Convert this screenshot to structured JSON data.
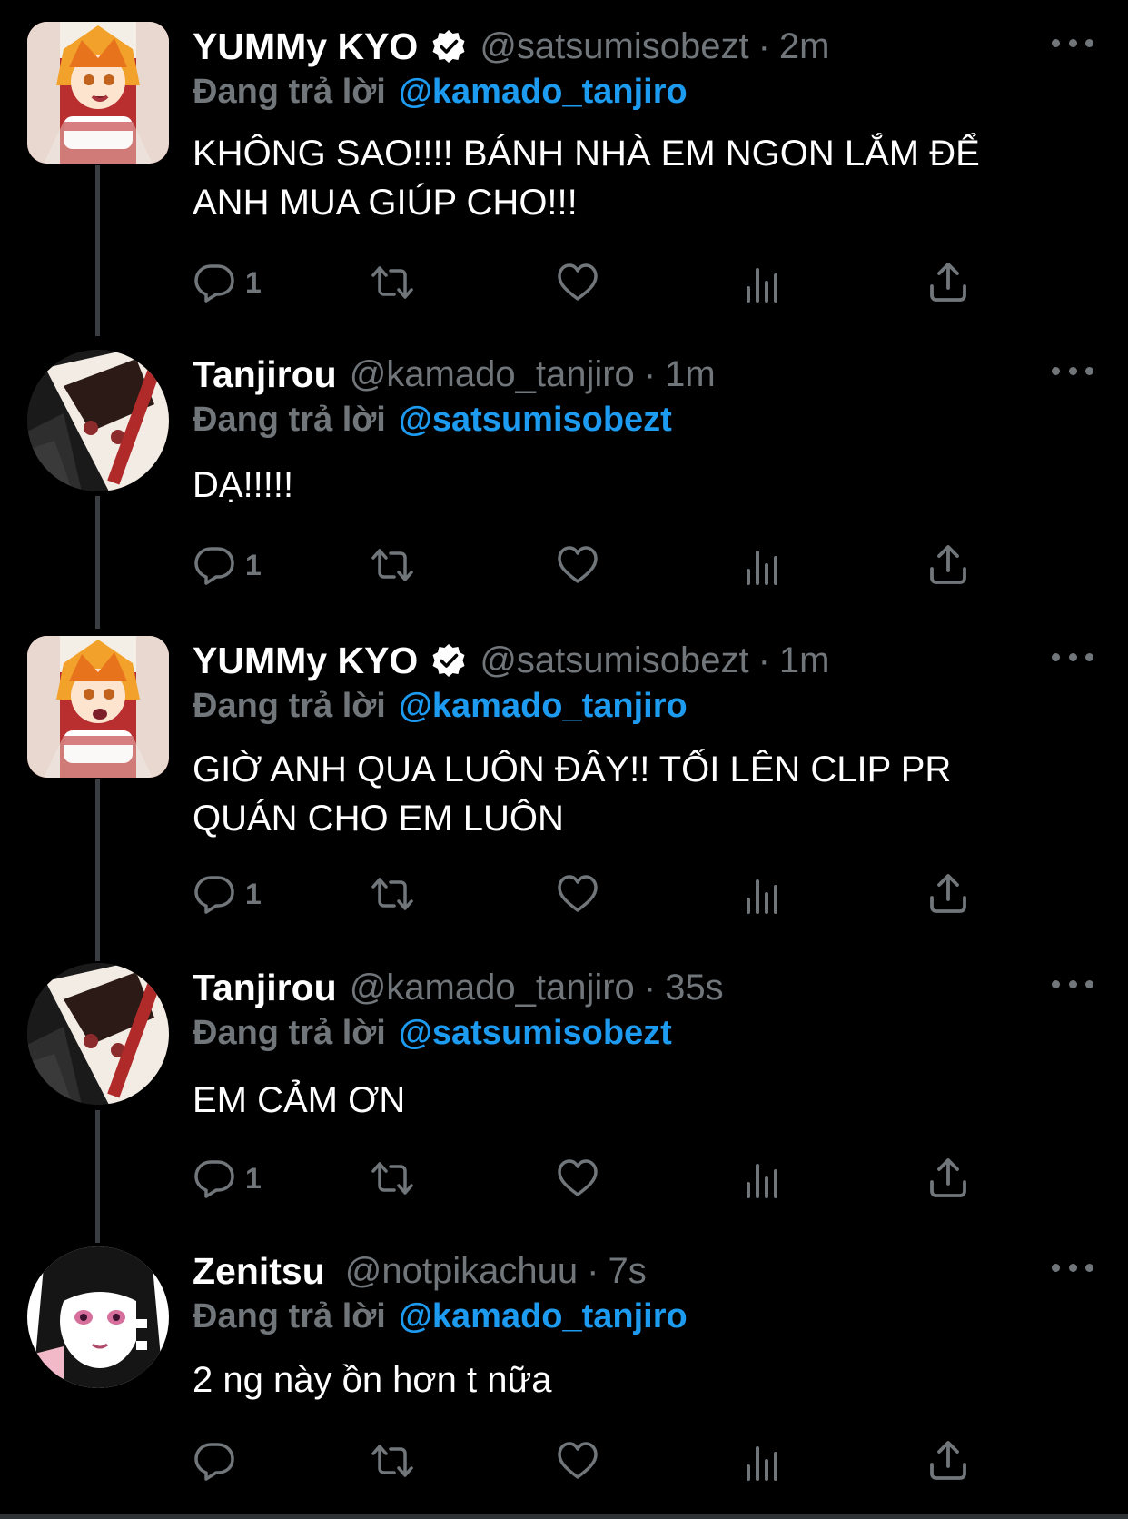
{
  "colors": {
    "background": "#000000",
    "text": "#ffffff",
    "muted": "#71767b",
    "link": "#1d9bf0",
    "thread_line": "#3a3d41"
  },
  "tweets": [
    {
      "display_name": "YUMMy KYO",
      "verified": true,
      "handle": "@satsumisobezt",
      "separator": "·",
      "time": "2m",
      "replying_label": "Đang trả lời",
      "replying_to": "@kamado_tanjiro",
      "text_lines": [
        "KHÔNG SAO!!!! BÁNH NHÀ EM NGON LẮM ĐỂ",
        "ANH MUA GIÚP CHO!!!"
      ],
      "reply_count": "1",
      "avatar_icon": "rengoku-avatar"
    },
    {
      "display_name": "Tanjirou",
      "verified": false,
      "handle": "@kamado_tanjiro",
      "separator": "·",
      "time": "1m",
      "replying_label": "Đang trả lời",
      "replying_to": "@satsumisobezt",
      "text_lines": [
        "DẠ!!!!!"
      ],
      "reply_count": "1",
      "avatar_icon": "tanjiro-avatar"
    },
    {
      "display_name": "YUMMy KYO",
      "verified": true,
      "handle": "@satsumisobezt",
      "separator": "·",
      "time": "1m",
      "replying_label": "Đang trả lời",
      "replying_to": "@kamado_tanjiro",
      "text_lines": [
        "GIỜ ANH QUA LUÔN ĐÂY!! TỐI LÊN CLIP PR",
        "QUÁN CHO EM LUÔN"
      ],
      "reply_count": "1",
      "avatar_icon": "rengoku-avatar"
    },
    {
      "display_name": "Tanjirou",
      "verified": false,
      "handle": "@kamado_tanjiro",
      "separator": "·",
      "time": "35s",
      "replying_label": "Đang trả lời",
      "replying_to": "@satsumisobezt",
      "text_lines": [
        "EM CẢM ƠN"
      ],
      "reply_count": "1",
      "avatar_icon": "tanjiro-avatar"
    },
    {
      "display_name": "Zenitsu",
      "verified": false,
      "handle": "@notpikachuu",
      "separator": "·",
      "time": "7s",
      "replying_label": "Đang trả lời",
      "replying_to": "@kamado_tanjiro",
      "text_lines": [
        "2 ng này ồn hơn t nữa"
      ],
      "reply_count": "",
      "avatar_icon": "kanao-avatar"
    }
  ],
  "icons": {
    "reply": "reply-icon",
    "retweet": "retweet-icon",
    "like": "heart-icon",
    "views": "views-icon",
    "share": "share-icon",
    "more": "more-icon",
    "verified": "verified-badge-icon"
  }
}
